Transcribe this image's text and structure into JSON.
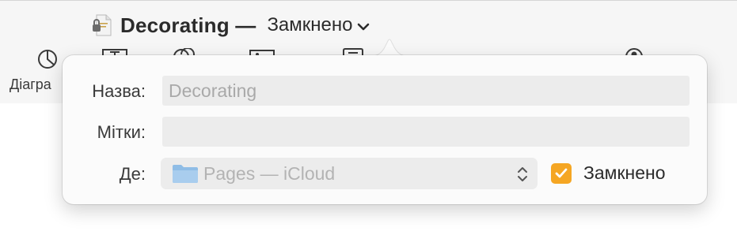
{
  "title_bar": {
    "document_name": "Decorating —",
    "status": "Замкнено"
  },
  "toolbar": {
    "visible_label": "Діагра",
    "icons": [
      "chart-icon",
      "text-box-icon",
      "shape-icon",
      "media-icon",
      "comment-icon",
      "collaborate-icon"
    ]
  },
  "popover": {
    "name_label": "Назва:",
    "name_value": "Decorating",
    "tags_label": "Мітки:",
    "tags_value": "",
    "where_label": "Де:",
    "where_value": "Pages — iCloud",
    "locked_label": "Замкнено",
    "locked_checked": true
  },
  "colors": {
    "accent_checkbox": "#f5a623",
    "field_background": "#ececec",
    "toolbar_background": "#f6f6f6"
  }
}
